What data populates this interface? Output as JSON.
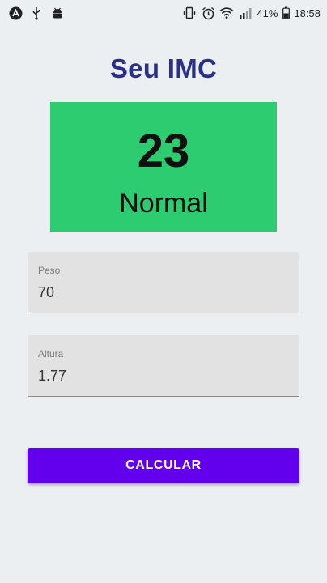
{
  "status_bar": {
    "left_icons": [
      "app-logo-icon",
      "usb-icon",
      "android-debug-icon"
    ],
    "right_icons": [
      "vibrate-icon",
      "alarm-icon",
      "wifi-icon",
      "signal-icon",
      "battery-icon"
    ],
    "battery_percent": "41%",
    "time": "18:58"
  },
  "title": "Seu IMC",
  "result": {
    "value": "23",
    "label": "Normal",
    "color": "#2ecc71"
  },
  "form": {
    "weight": {
      "label": "Peso",
      "value": "70"
    },
    "height": {
      "label": "Altura",
      "value": "1.77"
    }
  },
  "button": {
    "label": "CALCULAR",
    "color": "#6200ee"
  },
  "colors": {
    "background": "#eceff1",
    "title": "#2a3088"
  }
}
